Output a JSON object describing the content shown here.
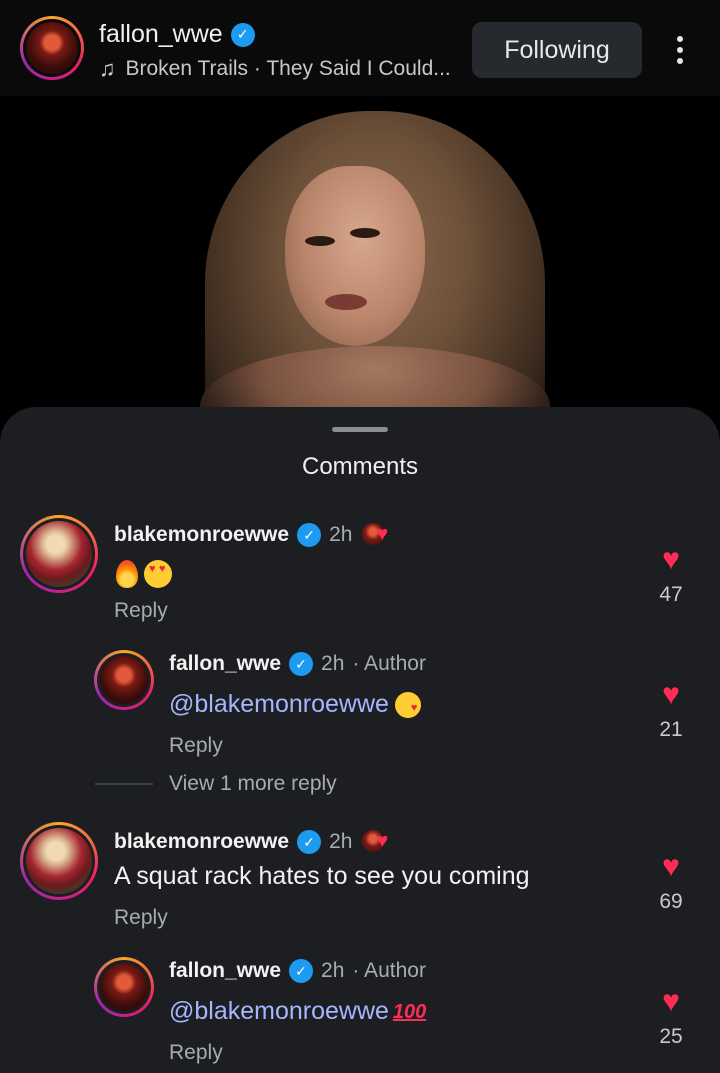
{
  "header": {
    "username": "fallon_wwe",
    "music": "Broken Trails · They Said I Could...",
    "follow_label": "Following",
    "icons": [
      "music-note-icon",
      "verified-badge-icon",
      "more-options-icon"
    ]
  },
  "sheet": {
    "title": "Comments"
  },
  "comments": [
    {
      "username": "blakemonroewwe",
      "time": "2h",
      "text": "🔥😍",
      "reply_label": "Reply",
      "likes": "47"
    },
    {
      "username": "fallon_wwe",
      "time": "2h",
      "author_label": "· Author",
      "mention": "@blakemonroewwe",
      "reply_label": "Reply",
      "likes": "21"
    },
    {
      "username": "blakemonroewwe",
      "time": "2h",
      "text": "A squat rack hates to see you coming",
      "reply_label": "Reply",
      "likes": "69"
    },
    {
      "username": "fallon_wwe",
      "time": "2h",
      "author_label": "· Author",
      "mention": "@blakemonroewwe",
      "reply_label": "Reply",
      "likes": "25"
    }
  ],
  "view_more": "View 1 more reply",
  "colors": {
    "accent_heart": "#ff2d55",
    "verified": "#1d9bf0",
    "mention": "#a5b6ff",
    "sheet_bg": "#1c1e21"
  }
}
